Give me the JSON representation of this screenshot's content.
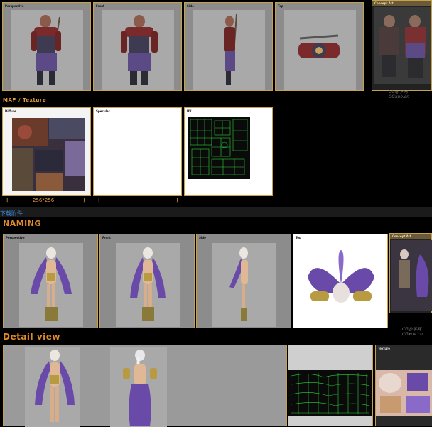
{
  "top_views": {
    "panels": [
      {
        "label": "Perspective"
      },
      {
        "label": "Front"
      },
      {
        "label": "Side"
      },
      {
        "label": "Top"
      }
    ],
    "concept_label": "Concept Art"
  },
  "map_section": {
    "title": "MAP / Texture",
    "panels": [
      {
        "label": "Diffuse"
      },
      {
        "label": "Specular"
      },
      {
        "label": "UV"
      }
    ],
    "diffuse_bracket_left": "[",
    "diffuse_size": "256*256",
    "diffuse_bracket_right": "]",
    "specular_bracket_left": "[",
    "specular_bracket_right": "]"
  },
  "download_link": "下载附件",
  "naming_section": {
    "title": "NAMING",
    "panels": [
      {
        "label": "Perspective"
      },
      {
        "label": "Front"
      },
      {
        "label": "Side"
      },
      {
        "label": "Top"
      }
    ],
    "concept_label": "Concept Art"
  },
  "detail_section": {
    "title": "Detail view",
    "texture_label": "Texture"
  },
  "watermarks": {
    "wm1_line1": "CG@学网",
    "wm1_line2": "CGxue.cn",
    "wm2_line1": "CG@学网",
    "wm2_line2": "CGxue.cn"
  },
  "colors": {
    "panel_border": "#c8a24a",
    "section_orange": "#e08a2a",
    "download_blue": "#3a8fe0",
    "uv_green": "#2fd03a"
  }
}
